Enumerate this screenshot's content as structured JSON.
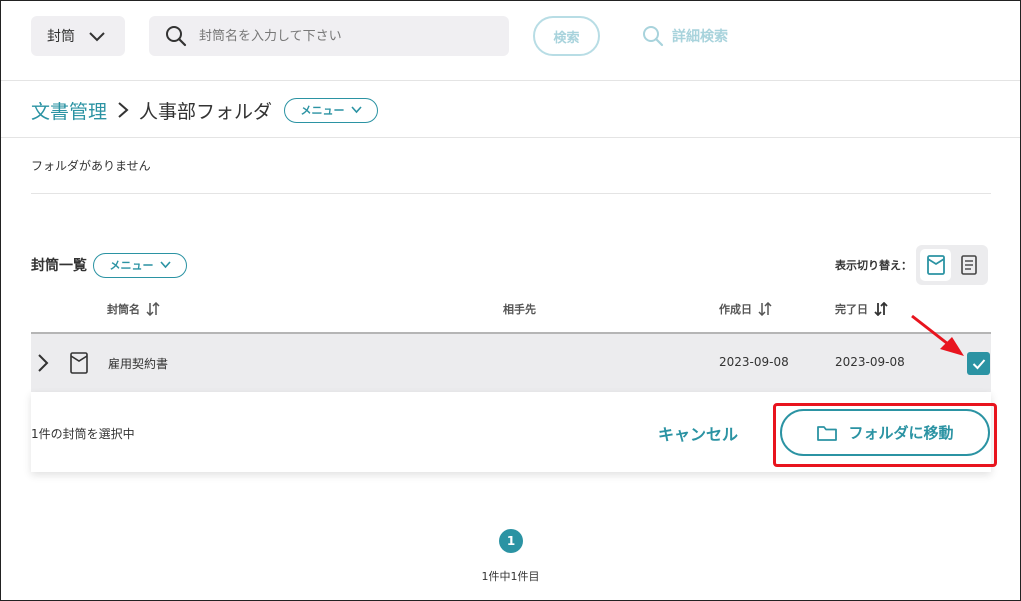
{
  "header": {
    "type_select": {
      "value": "封筒"
    },
    "search": {
      "placeholder": "封筒名を入力して下さい",
      "value": ""
    },
    "search_button_label": "検索",
    "advanced_search_label": "詳細検索"
  },
  "breadcrumb": {
    "root": "文書管理",
    "current": "人事部フォルダ",
    "menu_label": "メニュー"
  },
  "folders": {
    "empty_message": "フォルダがありません"
  },
  "envelope_list": {
    "title": "封筒一覧",
    "menu_label": "メニュー",
    "view_switch_label": "表示切り替え：",
    "columns": {
      "name": "封筒名",
      "recipient": "相手先",
      "created": "作成日",
      "completed": "完了日"
    },
    "rows": [
      {
        "name": "雇用契約書",
        "recipient": "",
        "created": "2023-09-08",
        "completed": "2023-09-08",
        "checked": true
      }
    ]
  },
  "action_bar": {
    "selected_text": "1件の封筒を選択中",
    "cancel_label": "キャンセル",
    "move_label": "フォルダに移動"
  },
  "pagination": {
    "current_page": "1",
    "info": "1件中1件目"
  },
  "colors": {
    "accent": "#2b93a3",
    "highlight": "#e8141e",
    "row_bg": "#ececee"
  }
}
